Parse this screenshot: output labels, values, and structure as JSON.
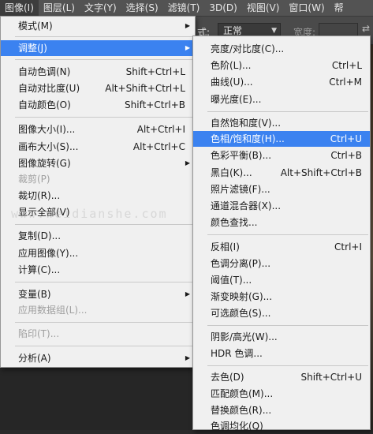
{
  "menubar": {
    "items": [
      {
        "label": "图像(I)",
        "active": true
      },
      {
        "label": "图层(L)"
      },
      {
        "label": "文字(Y)"
      },
      {
        "label": "选择(S)"
      },
      {
        "label": "滤镜(T)"
      },
      {
        "label": "3D(D)"
      },
      {
        "label": "视图(V)"
      },
      {
        "label": "窗口(W)"
      },
      {
        "label": "帮"
      }
    ]
  },
  "options_bar": {
    "mode_label": "式:",
    "mode_value": "正常",
    "width_label": "宽度:",
    "swap_icon": "⇄"
  },
  "watermark": "www.weidianshe.com",
  "image_menu": {
    "items": [
      {
        "label": "模式(M)",
        "shortcut": "",
        "submenu": true
      },
      {
        "label": "调整(J)",
        "shortcut": "",
        "submenu": true,
        "highlight": true
      },
      {
        "label": "自动色调(N)",
        "shortcut": "Shift+Ctrl+L"
      },
      {
        "label": "自动对比度(U)",
        "shortcut": "Alt+Shift+Ctrl+L"
      },
      {
        "label": "自动颜色(O)",
        "shortcut": "Shift+Ctrl+B"
      },
      {
        "label": "图像大小(I)...",
        "shortcut": "Alt+Ctrl+I"
      },
      {
        "label": "画布大小(S)...",
        "shortcut": "Alt+Ctrl+C"
      },
      {
        "label": "图像旋转(G)",
        "shortcut": "",
        "submenu": true
      },
      {
        "label": "裁剪(P)",
        "shortcut": "",
        "disabled": true
      },
      {
        "label": "裁切(R)...",
        "shortcut": ""
      },
      {
        "label": "显示全部(V)",
        "shortcut": ""
      },
      {
        "label": "复制(D)...",
        "shortcut": ""
      },
      {
        "label": "应用图像(Y)...",
        "shortcut": ""
      },
      {
        "label": "计算(C)...",
        "shortcut": ""
      },
      {
        "label": "变量(B)",
        "shortcut": "",
        "submenu": true
      },
      {
        "label": "应用数据组(L)...",
        "shortcut": "",
        "disabled": true
      },
      {
        "label": "陷印(T)...",
        "shortcut": "",
        "disabled": true
      },
      {
        "label": "分析(A)",
        "shortcut": "",
        "submenu": true
      }
    ]
  },
  "adjust_menu": {
    "items": [
      {
        "label": "亮度/对比度(C)...",
        "shortcut": ""
      },
      {
        "label": "色阶(L)...",
        "shortcut": "Ctrl+L"
      },
      {
        "label": "曲线(U)...",
        "shortcut": "Ctrl+M"
      },
      {
        "label": "曝光度(E)...",
        "shortcut": ""
      },
      {
        "label": "自然饱和度(V)...",
        "shortcut": ""
      },
      {
        "label": "色相/饱和度(H)...",
        "shortcut": "Ctrl+U",
        "highlight": true
      },
      {
        "label": "色彩平衡(B)...",
        "shortcut": "Ctrl+B"
      },
      {
        "label": "黑白(K)...",
        "shortcut": "Alt+Shift+Ctrl+B"
      },
      {
        "label": "照片滤镜(F)...",
        "shortcut": ""
      },
      {
        "label": "通道混合器(X)...",
        "shortcut": ""
      },
      {
        "label": "颜色查找...",
        "shortcut": ""
      },
      {
        "label": "反相(I)",
        "shortcut": "Ctrl+I"
      },
      {
        "label": "色调分离(P)...",
        "shortcut": ""
      },
      {
        "label": "阈值(T)...",
        "shortcut": ""
      },
      {
        "label": "渐变映射(G)...",
        "shortcut": ""
      },
      {
        "label": "可选颜色(S)...",
        "shortcut": ""
      },
      {
        "label": "阴影/高光(W)...",
        "shortcut": ""
      },
      {
        "label": "HDR 色调...",
        "shortcut": ""
      },
      {
        "label": "去色(D)",
        "shortcut": "Shift+Ctrl+U"
      },
      {
        "label": "匹配颜色(M)...",
        "shortcut": ""
      },
      {
        "label": "替换颜色(R)...",
        "shortcut": ""
      },
      {
        "label": "色调均化(Q)",
        "shortcut": ""
      }
    ]
  }
}
